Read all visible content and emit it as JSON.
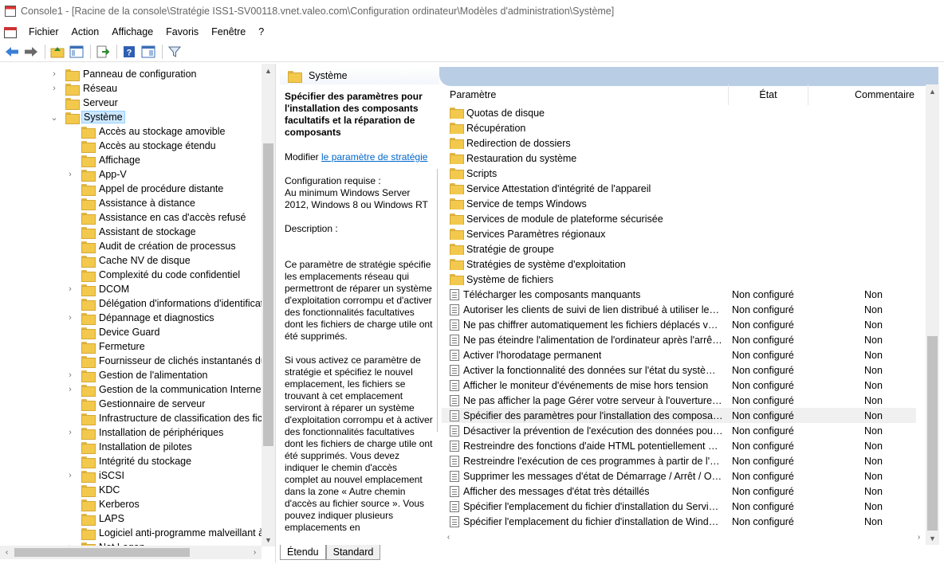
{
  "window": {
    "title": "Console1 - [Racine de la console\\Stratégie ISS1-SV00118.vnet.valeo.com\\Configuration ordinateur\\Modèles d'administration\\Système]"
  },
  "menu": [
    "Fichier",
    "Action",
    "Affichage",
    "Favoris",
    "Fenêtre",
    "?"
  ],
  "toolbar": [
    "back-icon",
    "forward-icon",
    "up-folder-icon",
    "show-tree-icon",
    "export-list-icon",
    "help-icon",
    "show-pane-icon",
    "filter-icon"
  ],
  "tree": {
    "items": [
      {
        "label": "Panneau de configuration",
        "level": 0,
        "expander": "›"
      },
      {
        "label": "Réseau",
        "level": 0,
        "expander": "›"
      },
      {
        "label": "Serveur",
        "level": 0,
        "expander": ""
      },
      {
        "label": "Système",
        "level": 0,
        "expander": "⌄",
        "selected": true
      },
      {
        "label": "Accès au stockage amovible",
        "level": 1,
        "expander": ""
      },
      {
        "label": "Accès au stockage étendu",
        "level": 1,
        "expander": ""
      },
      {
        "label": "Affichage",
        "level": 1,
        "expander": ""
      },
      {
        "label": "App-V",
        "level": 1,
        "expander": "›"
      },
      {
        "label": "Appel de procédure distante",
        "level": 1,
        "expander": ""
      },
      {
        "label": "Assistance à distance",
        "level": 1,
        "expander": ""
      },
      {
        "label": "Assistance en cas d'accès refusé",
        "level": 1,
        "expander": ""
      },
      {
        "label": "Assistant de stockage",
        "level": 1,
        "expander": ""
      },
      {
        "label": "Audit de création de processus",
        "level": 1,
        "expander": ""
      },
      {
        "label": "Cache NV de disque",
        "level": 1,
        "expander": ""
      },
      {
        "label": "Complexité du code confidentiel",
        "level": 1,
        "expander": ""
      },
      {
        "label": "DCOM",
        "level": 1,
        "expander": "›"
      },
      {
        "label": "Délégation d'informations d'identificati",
        "level": 1,
        "expander": ""
      },
      {
        "label": "Dépannage et diagnostics",
        "level": 1,
        "expander": "›"
      },
      {
        "label": "Device Guard",
        "level": 1,
        "expander": ""
      },
      {
        "label": "Fermeture",
        "level": 1,
        "expander": ""
      },
      {
        "label": "Fournisseur de clichés instantanés du pa",
        "level": 1,
        "expander": ""
      },
      {
        "label": "Gestion de l'alimentation",
        "level": 1,
        "expander": "›"
      },
      {
        "label": "Gestion de la communication Internet",
        "level": 1,
        "expander": "›"
      },
      {
        "label": "Gestionnaire de serveur",
        "level": 1,
        "expander": ""
      },
      {
        "label": "Infrastructure de classification des fichi",
        "level": 1,
        "expander": ""
      },
      {
        "label": "Installation de périphériques",
        "level": 1,
        "expander": "›"
      },
      {
        "label": "Installation de pilotes",
        "level": 1,
        "expander": ""
      },
      {
        "label": "Intégrité du stockage",
        "level": 1,
        "expander": ""
      },
      {
        "label": "iSCSI",
        "level": 1,
        "expander": "›"
      },
      {
        "label": "KDC",
        "level": 1,
        "expander": ""
      },
      {
        "label": "Kerberos",
        "level": 1,
        "expander": ""
      },
      {
        "label": "LAPS",
        "level": 1,
        "expander": ""
      },
      {
        "label": "Logiciel anti-programme malveillant à l",
        "level": 1,
        "expander": ""
      },
      {
        "label": "Net Logon",
        "level": 1,
        "expander": "›"
      }
    ]
  },
  "header": {
    "title": "Système"
  },
  "description": {
    "title": "Spécifier des paramètres pour l'installation des composants facultatifs et la réparation de composants",
    "edit_prefix": "Modifier ",
    "edit_link": "le paramètre de stratégie",
    "requirements": "Configuration requise :\nAu minimum Windows Server 2012, Windows 8 ou Windows RT",
    "description_label": "Description :",
    "body1": "Ce paramètre de stratégie spécifie les emplacements réseau qui permettront de réparer un système d'exploitation corrompu et d'activer des fonctionnalités facultatives dont les fichiers de charge utile ont été supprimés.",
    "body2": "Si vous activez ce paramètre de stratégie et spécifiez le nouvel emplacement, les fichiers se trouvant à cet emplacement serviront à réparer un système d'exploitation corrompu et à activer des fonctionnalités facultatives dont les fichiers de charge utile ont été supprimés. Vous devez indiquer le chemin d'accès complet au nouvel emplacement dans la zone « Autre chemin d'accès au fichier source ». Vous pouvez indiquer plusieurs emplacements en"
  },
  "list": {
    "columns": [
      "Paramètre",
      "État",
      "Commentaire"
    ],
    "rows": [
      {
        "type": "folder",
        "name": "Quotas de disque",
        "state": "",
        "comment": ""
      },
      {
        "type": "folder",
        "name": "Récupération",
        "state": "",
        "comment": ""
      },
      {
        "type": "folder",
        "name": "Redirection de dossiers",
        "state": "",
        "comment": ""
      },
      {
        "type": "folder",
        "name": "Restauration du système",
        "state": "",
        "comment": ""
      },
      {
        "type": "folder",
        "name": "Scripts",
        "state": "",
        "comment": ""
      },
      {
        "type": "folder",
        "name": "Service Attestation d'intégrité de l'appareil",
        "state": "",
        "comment": ""
      },
      {
        "type": "folder",
        "name": "Service de temps Windows",
        "state": "",
        "comment": ""
      },
      {
        "type": "folder",
        "name": "Services de module de plateforme sécurisée",
        "state": "",
        "comment": ""
      },
      {
        "type": "folder",
        "name": "Services Paramètres régionaux",
        "state": "",
        "comment": ""
      },
      {
        "type": "folder",
        "name": "Stratégie de groupe",
        "state": "",
        "comment": ""
      },
      {
        "type": "folder",
        "name": "Stratégies de système d'exploitation",
        "state": "",
        "comment": ""
      },
      {
        "type": "folder",
        "name": "Système de fichiers",
        "state": "",
        "comment": ""
      },
      {
        "type": "policy",
        "name": "Télécharger les composants manquants",
        "state": "Non configuré",
        "comment": "Non"
      },
      {
        "type": "policy",
        "name": "Autoriser les clients de suivi de lien distribué à utiliser les res...",
        "state": "Non configuré",
        "comment": "Non"
      },
      {
        "type": "policy",
        "name": "Ne pas chiffrer automatiquement les fichiers déplacés vers d...",
        "state": "Non configuré",
        "comment": "Non"
      },
      {
        "type": "policy",
        "name": "Ne pas éteindre l'alimentation de l'ordinateur après l'arrêt d...",
        "state": "Non configuré",
        "comment": "Non"
      },
      {
        "type": "policy",
        "name": "Activer l'horodatage permanent",
        "state": "Non configuré",
        "comment": "Non"
      },
      {
        "type": "policy",
        "name": "Activer la fonctionnalité des données sur l'état du système d...",
        "state": "Non configuré",
        "comment": "Non"
      },
      {
        "type": "policy",
        "name": "Afficher le moniteur d'événements de mise hors tension",
        "state": "Non configuré",
        "comment": "Non"
      },
      {
        "type": "policy",
        "name": "Ne pas afficher la page Gérer votre serveur à l'ouverture de s...",
        "state": "Non configuré",
        "comment": "Non"
      },
      {
        "type": "policy",
        "name": "Spécifier des paramètres pour l'installation des composants ...",
        "state": "Non configuré",
        "comment": "Non",
        "selected": true
      },
      {
        "type": "policy",
        "name": "Désactiver la prévention de l'exécution des données pour l'e...",
        "state": "Non configuré",
        "comment": "Non"
      },
      {
        "type": "policy",
        "name": "Restreindre des fonctions d'aide HTML potentiellement non ...",
        "state": "Non configuré",
        "comment": "Non"
      },
      {
        "type": "policy",
        "name": "Restreindre l'exécution de ces programmes à partir de l'aide",
        "state": "Non configuré",
        "comment": "Non"
      },
      {
        "type": "policy",
        "name": "Supprimer les messages d'état de Démarrage / Arrêt / Ouver...",
        "state": "Non configuré",
        "comment": "Non"
      },
      {
        "type": "policy",
        "name": "Afficher des messages d'état très détaillés",
        "state": "Non configuré",
        "comment": "Non"
      },
      {
        "type": "policy",
        "name": "Spécifier l'emplacement du fichier d'installation du Service ...",
        "state": "Non configuré",
        "comment": "Non"
      },
      {
        "type": "policy",
        "name": "Spécifier l'emplacement du fichier d'installation de Windows",
        "state": "Non configuré",
        "comment": "Non"
      }
    ]
  },
  "tabs": [
    "Étendu",
    "Standard"
  ]
}
